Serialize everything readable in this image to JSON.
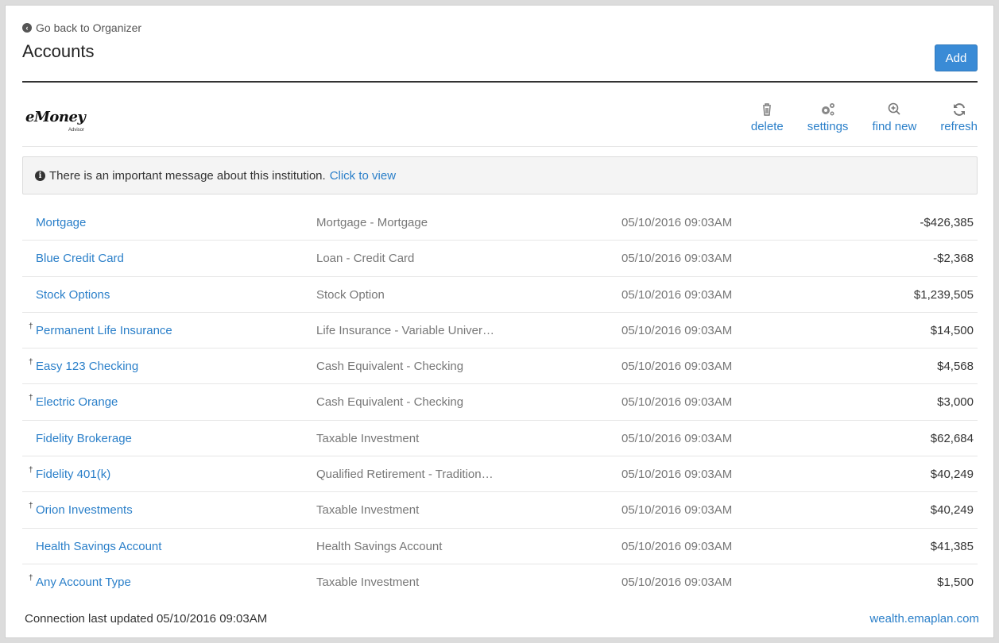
{
  "header": {
    "back_link": "Go back to Organizer",
    "title": "Accounts",
    "add_label": "Add"
  },
  "institution": {
    "logo_text": "eMoney",
    "logo_sub": "Advisor",
    "toolbar": {
      "delete": "delete",
      "settings": "settings",
      "find_new": "find new",
      "refresh": "refresh"
    }
  },
  "notice": {
    "message": "There is an important message about this institution.",
    "link": "Click to view"
  },
  "accounts": [
    {
      "dagger": "",
      "name": "Mortgage",
      "type": "Mortgage - Mortgage",
      "updated": "05/10/2016 09:03AM",
      "amount": "-$426,385"
    },
    {
      "dagger": "",
      "name": "Blue Credit Card",
      "type": "Loan - Credit Card",
      "updated": "05/10/2016 09:03AM",
      "amount": "-$2,368"
    },
    {
      "dagger": "",
      "name": "Stock Options",
      "type": "Stock Option",
      "updated": "05/10/2016 09:03AM",
      "amount": "$1,239,505"
    },
    {
      "dagger": "†",
      "name": "Permanent Life Insurance",
      "type": "Life Insurance - Variable Univer…",
      "updated": "05/10/2016 09:03AM",
      "amount": "$14,500"
    },
    {
      "dagger": "†",
      "name": "Easy 123 Checking",
      "type": "Cash Equivalent - Checking",
      "updated": "05/10/2016 09:03AM",
      "amount": "$4,568"
    },
    {
      "dagger": "†",
      "name": "Electric Orange",
      "type": "Cash Equivalent - Checking",
      "updated": "05/10/2016 09:03AM",
      "amount": "$3,000"
    },
    {
      "dagger": "",
      "name": "Fidelity Brokerage",
      "type": "Taxable Investment",
      "updated": "05/10/2016 09:03AM",
      "amount": "$62,684"
    },
    {
      "dagger": "†",
      "name": "Fidelity 401(k)",
      "type": "Qualified Retirement - Tradition…",
      "updated": "05/10/2016 09:03AM",
      "amount": "$40,249"
    },
    {
      "dagger": "†",
      "name": "Orion Investments",
      "type": "Taxable Investment",
      "updated": "05/10/2016 09:03AM",
      "amount": "$40,249"
    },
    {
      "dagger": "",
      "name": "Health Savings Account",
      "type": "Health Savings Account",
      "updated": "05/10/2016 09:03AM",
      "amount": "$41,385"
    },
    {
      "dagger": "†",
      "name": "Any Account Type",
      "type": "Taxable Investment",
      "updated": "05/10/2016 09:03AM",
      "amount": "$1,500"
    }
  ],
  "footer": {
    "last_updated": "Connection last updated 05/10/2016 09:03AM",
    "site_link": "wealth.emaplan.com"
  },
  "colors": {
    "accent": "#2a7fc9",
    "button": "#3a8bd6",
    "muted_text": "#777777"
  },
  "icons": {
    "back": "circle-arrow-left-icon",
    "delete": "trash-icon",
    "settings": "gears-icon",
    "find_new": "zoom-in-icon",
    "refresh": "refresh-icon",
    "notice": "info-circle-icon"
  }
}
